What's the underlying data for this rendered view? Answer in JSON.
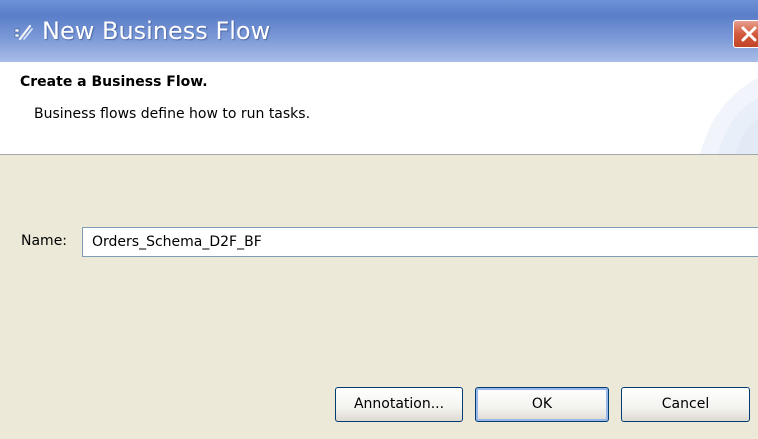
{
  "window": {
    "title": "New Business Flow",
    "title_icon": "business-flow-wizard-icon",
    "close_icon": "close-icon"
  },
  "header": {
    "title": "Create a Business Flow.",
    "description": "Business flows define how to run tasks."
  },
  "form": {
    "name_label": "Name:",
    "name_value": "Orders_Schema_D2F_BF"
  },
  "buttons": {
    "annotation": "Annotation...",
    "ok": "OK",
    "cancel": "Cancel"
  },
  "colors": {
    "title_bar": "#5a7ec8",
    "dialog_background": "#ece9d8",
    "close_button": "#d25a3c",
    "button_border": "#003c74"
  }
}
